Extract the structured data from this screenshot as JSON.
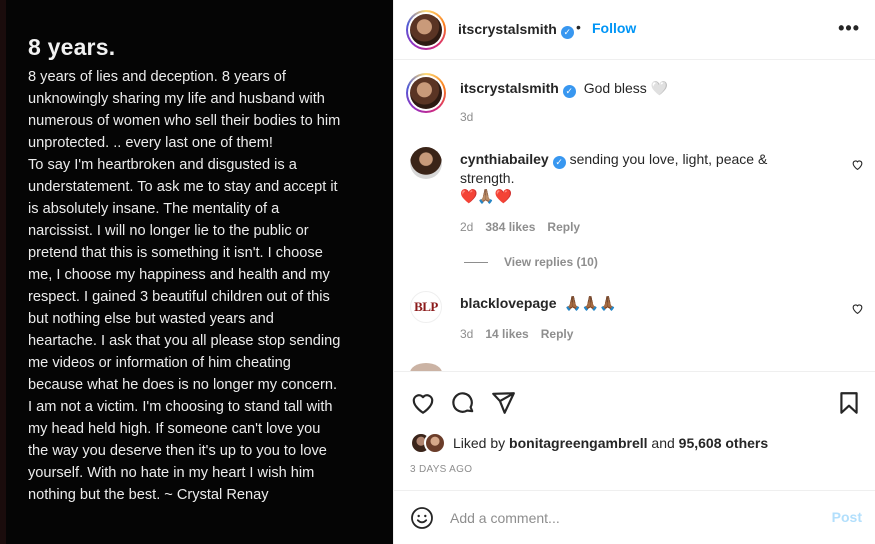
{
  "image": {
    "title": "8 years.",
    "lines": [
      "8 years of lies and deception. 8 years of",
      "unknowingly sharing my life and husband with",
      "numerous of women who sell their bodies to him",
      "unprotected. .. every last one of them!",
      "To say I'm heartbroken and disgusted is a",
      "understatement. To ask me to stay and accept it",
      "is absolutely insane. The mentality of a",
      "narcissist. I will no longer lie to the public or",
      "pretend that this is something it isn't. I choose",
      "me, I choose my happiness and health and my",
      "respect. I gained 3 beautiful children out of this",
      "but nothing else but wasted years and",
      "heartache. I ask that you all please stop sending",
      "me videos or information of him cheating",
      "because what he does is no longer my concern.",
      "I am not a victim. I'm choosing to stand tall with",
      "my head held high. If someone can't love you",
      "the way you deserve then it's up to you to love",
      "yourself. With no hate in my heart I wish him",
      "nothing but the best. ~ Crystal Renay"
    ]
  },
  "header": {
    "username": "itscrystalsmith",
    "separator": "•",
    "follow_label": "Follow",
    "more_label": "•••"
  },
  "caption": {
    "username": "itscrystalsmith",
    "text": "God bless 🤍",
    "time": "3d"
  },
  "comments": [
    {
      "username": "cynthiabailey",
      "text_line1": "sending you love, light, peace &",
      "text_line2": "strength.",
      "text_line3": "❤️🙏🏽❤️",
      "time": "2d",
      "likes": "384 likes",
      "reply": "Reply",
      "view_replies": "View replies (10)"
    },
    {
      "username": "blacklovepage",
      "avatar_text": "BLP",
      "text": "🙏🏾🙏🏾🙏🏾",
      "time": "3d",
      "likes": "14 likes",
      "reply": "Reply"
    }
  ],
  "likes": {
    "prefix": "Liked by ",
    "user": "bonitagreengambrell",
    "middle": " and ",
    "count": "95,608 others"
  },
  "posted": "3 DAYS AGO",
  "add_comment": {
    "placeholder": "Add a comment...",
    "post_label": "Post"
  },
  "colors": {
    "link_blue": "#0095f6",
    "verified_blue": "#3897f0",
    "post_disabled": "#b2dffc",
    "muted_text": "#8e8e8e",
    "like_red": "#ed4956"
  }
}
